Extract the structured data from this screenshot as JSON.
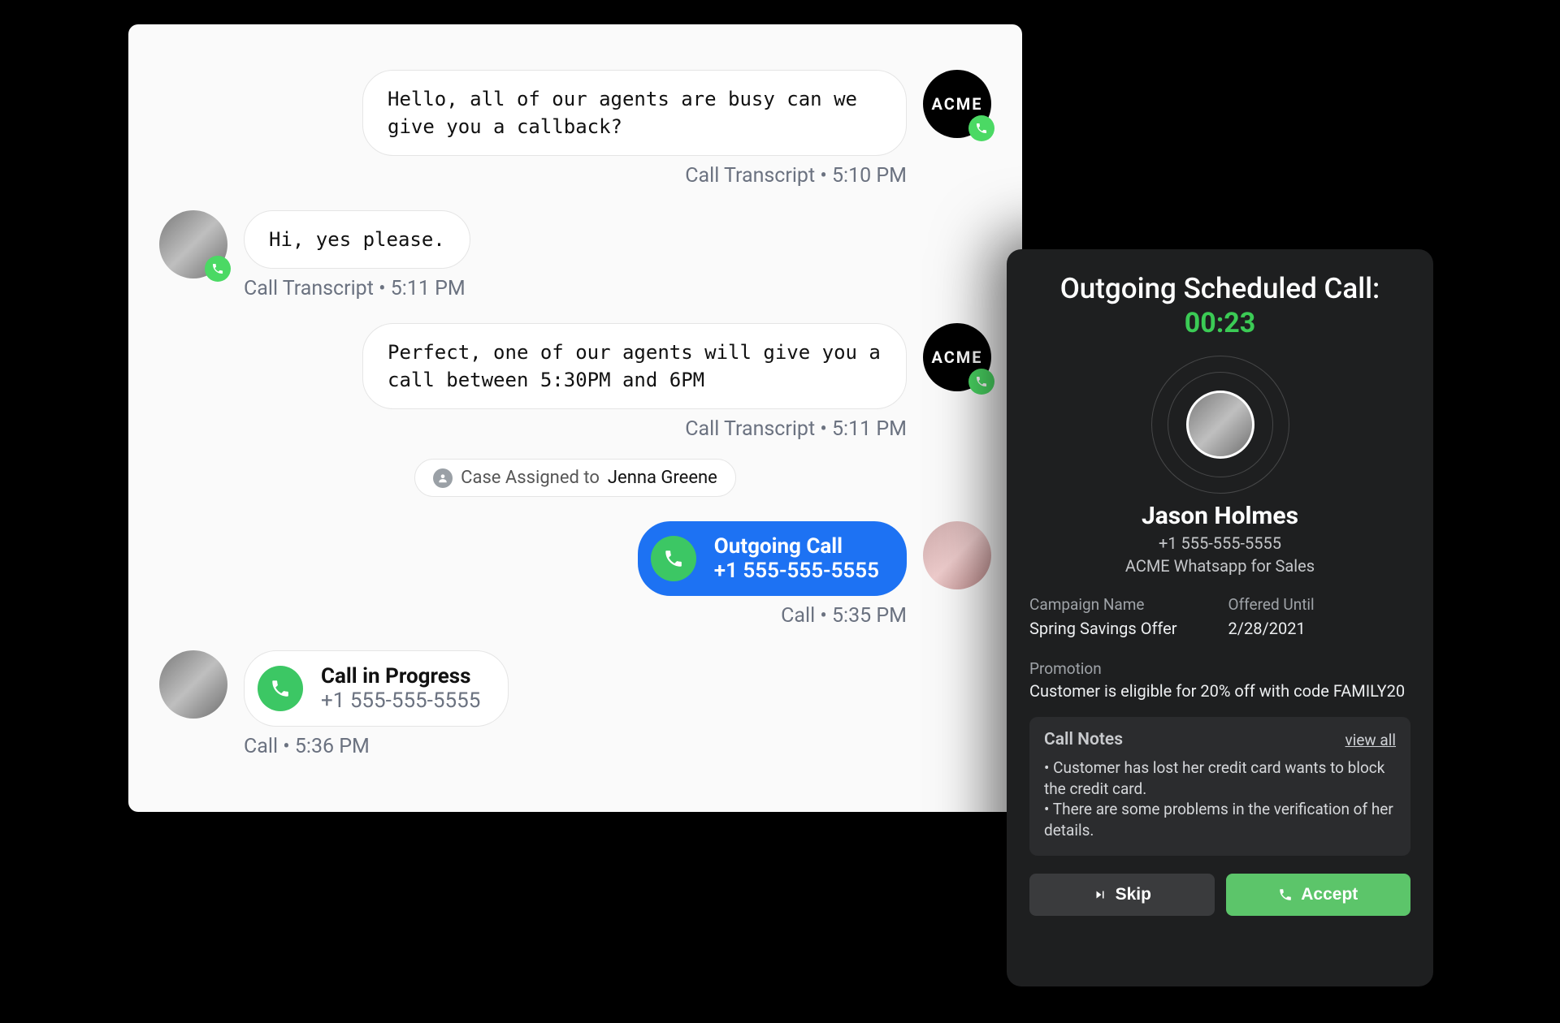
{
  "transcript": {
    "items": [
      {
        "side": "right",
        "avatar": "acme",
        "text": "Hello, all of our agents are busy can we give you a callback?",
        "meta": "Call Transcript • 5:10 PM"
      },
      {
        "side": "left",
        "avatar": "person",
        "text": "Hi, yes please.",
        "meta": "Call Transcript • 5:11 PM"
      },
      {
        "side": "right",
        "avatar": "acme",
        "text": "Perfect, one of our agents will give you a call between 5:30PM and 6PM",
        "meta": "Call Transcript • 5:11 PM"
      }
    ],
    "chip": {
      "prefix": "Case Assigned to ",
      "assignee": "Jenna Greene"
    },
    "outgoing": {
      "title": "Outgoing Call",
      "phone": "+1 555-555-5555",
      "meta": "Call •  5:35 PM"
    },
    "inprogress": {
      "title": "Call in Progress",
      "phone": "+1 555-555-5555",
      "meta": "Call • 5:36 PM"
    }
  },
  "avatar_label": "ACME",
  "modal": {
    "title": "Outgoing Scheduled Call:",
    "timer": "00:23",
    "name": "Jason Holmes",
    "phone": "+1 555-555-5555",
    "channel": "ACME Whatsapp for Sales",
    "campaign_label": "Campaign Name",
    "campaign_value": "Spring Savings Offer",
    "offered_label": "Offered Until",
    "offered_value": "2/28/2021",
    "promotion_label": "Promotion",
    "promotion_value": "Customer is eligible for 20% off with code FAMILY20",
    "notes_title": "Call Notes",
    "view_all": "view all",
    "note1": "Customer has lost her credit card wants to block the credit card.",
    "note2": "There are some problems in the verification of her details.",
    "skip_label": "Skip",
    "accept_label": "Accept"
  }
}
